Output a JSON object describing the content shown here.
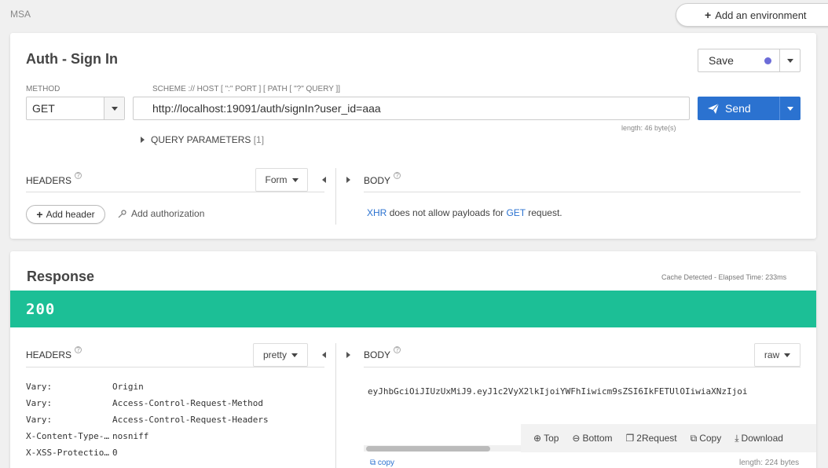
{
  "breadcrumb": "MSA",
  "environment_button": {
    "label": "Add an environment"
  },
  "request": {
    "title": "Auth - Sign In",
    "save_label": "Save",
    "method_label": "METHOD",
    "method_value": "GET",
    "scheme_label": "SCHEME :// HOST [ \":\" PORT ] [ PATH [ \"?\" QUERY ]]",
    "url": "http://localhost:19091/auth/signIn?user_id=aaa",
    "send_label": "Send",
    "length_text": "length: 46 byte(s)",
    "query_params_label": "QUERY PARAMETERS",
    "query_params_count": "[1]",
    "headers_label": "HEADERS",
    "headers_mode": "Form",
    "body_label": "BODY",
    "add_header_label": "Add header",
    "add_authorization_label": "Add authorization",
    "body_msg": {
      "xhr": "XHR",
      "middle": "does not allow payloads for",
      "method": "GET",
      "end": "request."
    }
  },
  "response": {
    "title": "Response",
    "cache_info": "Cache Detected - Elapsed Time: 233ms",
    "status_code": "200",
    "status_color": "#1cbf96",
    "headers_label": "HEADERS",
    "headers_mode": "pretty",
    "body_label": "BODY",
    "body_mode": "raw",
    "headers": [
      {
        "key": "Vary:",
        "value": "Origin"
      },
      {
        "key": "Vary:",
        "value": "Access-Control-Request-Method"
      },
      {
        "key": "Vary:",
        "value": "Access-Control-Request-Headers"
      },
      {
        "key": "X-Content-Type-Options:",
        "value": "nosniff"
      },
      {
        "key": "X-XSS-Protection:",
        "value": "0"
      }
    ],
    "body_text": "eyJhbGciOiJIUzUxMiJ9.eyJ1c2VyX2lkIjoiYWFhIiwicm9sZSI6IkFETUlOIiwiaXNzIjoi",
    "toolbar": {
      "top": "Top",
      "bottom": "Bottom",
      "to_request": "2Request",
      "copy": "Copy",
      "download": "Download"
    },
    "copy_link": "copy",
    "length_text": "length: 224 bytes"
  }
}
